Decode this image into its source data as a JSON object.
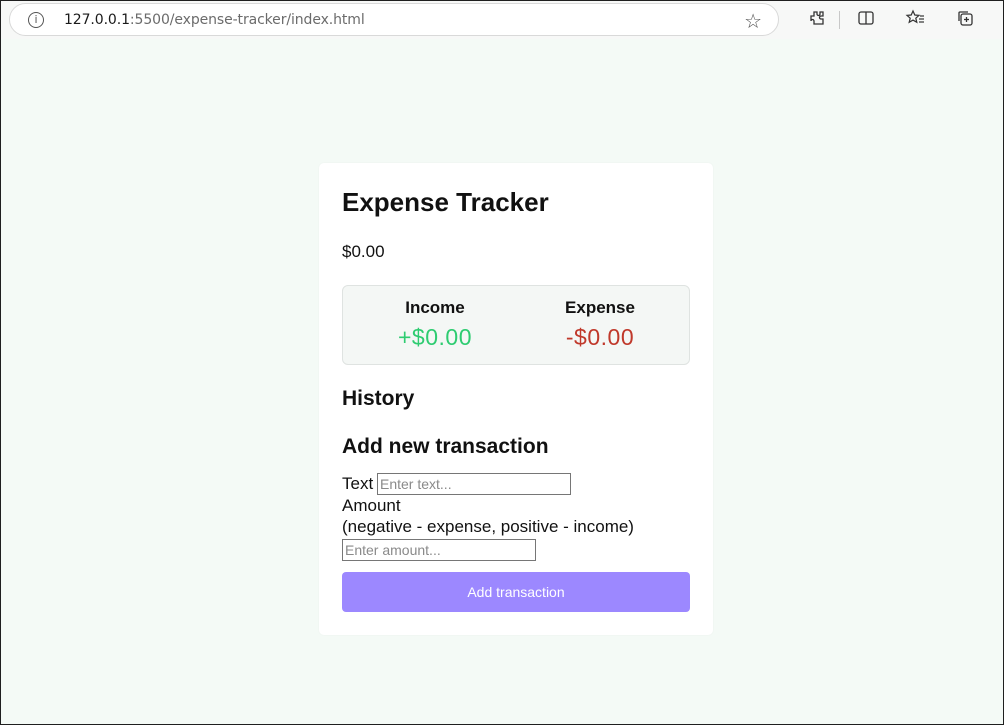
{
  "browser": {
    "url_host": "127.0.0.1",
    "url_rest": ":5500/expense-tracker/index.html",
    "info_icon": "i",
    "star_icon": "☆",
    "icons": [
      "extensions-icon",
      "split-screen-icon",
      "favorites-icon",
      "collections-icon"
    ]
  },
  "app": {
    "title": "Expense Tracker",
    "balance": "$0.00",
    "income_label": "Income",
    "income_value": "+$0.00",
    "expense_label": "Expense",
    "expense_value": "-$0.00",
    "history_heading": "History",
    "add_heading": "Add new transaction",
    "text_label": "Text",
    "text_placeholder": "Enter text...",
    "amount_label": "Amount",
    "amount_hint": "(negative - expense, positive - income)",
    "amount_placeholder": "Enter amount...",
    "add_button": "Add transaction"
  },
  "colors": {
    "income": "#2ecc71",
    "expense": "#c0392b",
    "button": "#9c88ff",
    "page_bg": "#f4faf6"
  }
}
